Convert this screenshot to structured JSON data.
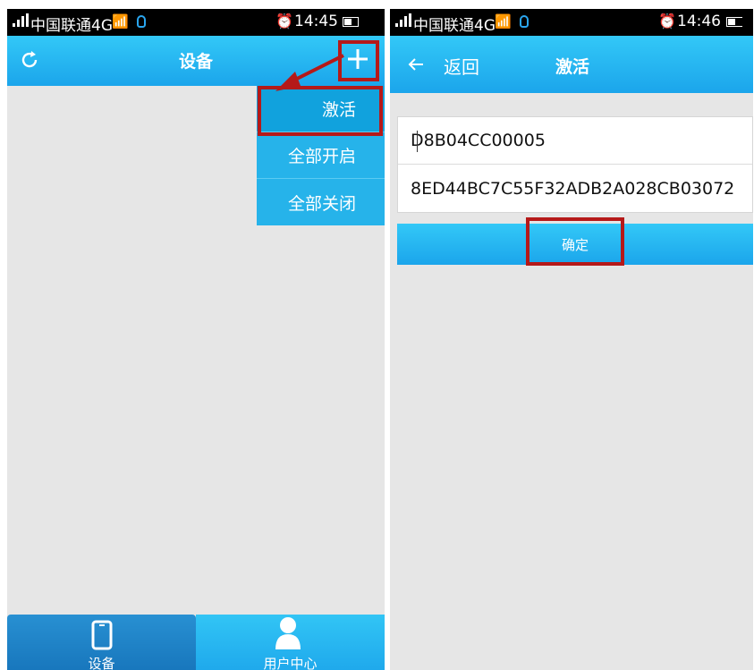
{
  "left_screen": {
    "status": {
      "carrier": "中国联通4G",
      "time": "14:45"
    },
    "header": {
      "title": "设备",
      "refresh_icon": "refresh-icon",
      "add_icon": "plus-icon"
    },
    "dropdown": {
      "items": [
        "激活",
        "全部开启",
        "全部关闭"
      ]
    },
    "tabbar": {
      "tabs": [
        {
          "label": "设备",
          "icon": "phone-icon"
        },
        {
          "label": "用户中心",
          "icon": "user-icon"
        }
      ]
    }
  },
  "right_screen": {
    "status": {
      "carrier": "中国联通4G",
      "time": "14:46"
    },
    "header": {
      "back_label": "返回",
      "title": "激活"
    },
    "form": {
      "fields": [
        {
          "value": "D8B04CC00005"
        },
        {
          "value": "8ED44BC7C55F32ADB2A028CB03072"
        }
      ]
    },
    "confirm_label": "确定"
  },
  "annotations": {
    "highlight_color": "#b51919"
  },
  "colors": {
    "accent": "#1ba5eb",
    "background": "#e6e6e6",
    "active_tab": "#1877bd"
  }
}
